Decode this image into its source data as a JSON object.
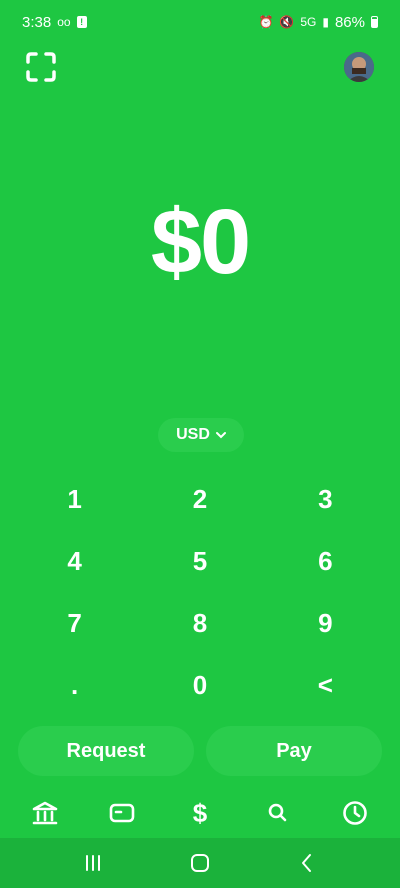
{
  "status_bar": {
    "time": "3:38",
    "network": "5G",
    "battery": "86%"
  },
  "icons": {
    "scan": "scan-qr-icon",
    "profile": "avatar"
  },
  "amount": "$0",
  "currency": {
    "label": "USD"
  },
  "keypad": {
    "keys": [
      "1",
      "2",
      "3",
      "4",
      "5",
      "6",
      "7",
      "8",
      "9",
      ".",
      "0",
      "<"
    ]
  },
  "actions": {
    "request": "Request",
    "pay": "Pay"
  },
  "bottom_nav": [
    {
      "name": "banking",
      "icon": "bank-icon"
    },
    {
      "name": "card",
      "icon": "card-icon"
    },
    {
      "name": "pay",
      "icon": "dollar-icon"
    },
    {
      "name": "search",
      "icon": "search-icon"
    },
    {
      "name": "activity",
      "icon": "clock-icon"
    }
  ],
  "colors": {
    "background": "#1ec742",
    "pill": "#2acd4d",
    "system_nav": "#1bb23b"
  }
}
